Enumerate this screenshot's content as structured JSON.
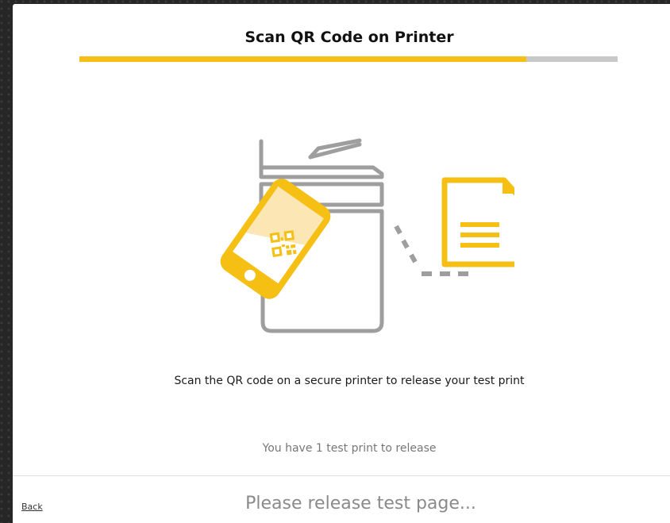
{
  "header": {
    "title": "Scan QR Code on Printer"
  },
  "progress": {
    "fraction": 0.83,
    "fill_color": "#f5bf14",
    "track_color": "#c8c8c8"
  },
  "illustration": {
    "icons": [
      "printer-icon",
      "phone-icon",
      "qr-code-icon",
      "document-icon"
    ],
    "accent_color": "#f5bf14",
    "line_color": "#9e9e9e"
  },
  "main": {
    "instruction": "Scan the QR code on a secure printer to release your test print",
    "count_text": "You have 1 test print to release"
  },
  "footer": {
    "back_label": "Back",
    "status_text": "Please release test page..."
  }
}
